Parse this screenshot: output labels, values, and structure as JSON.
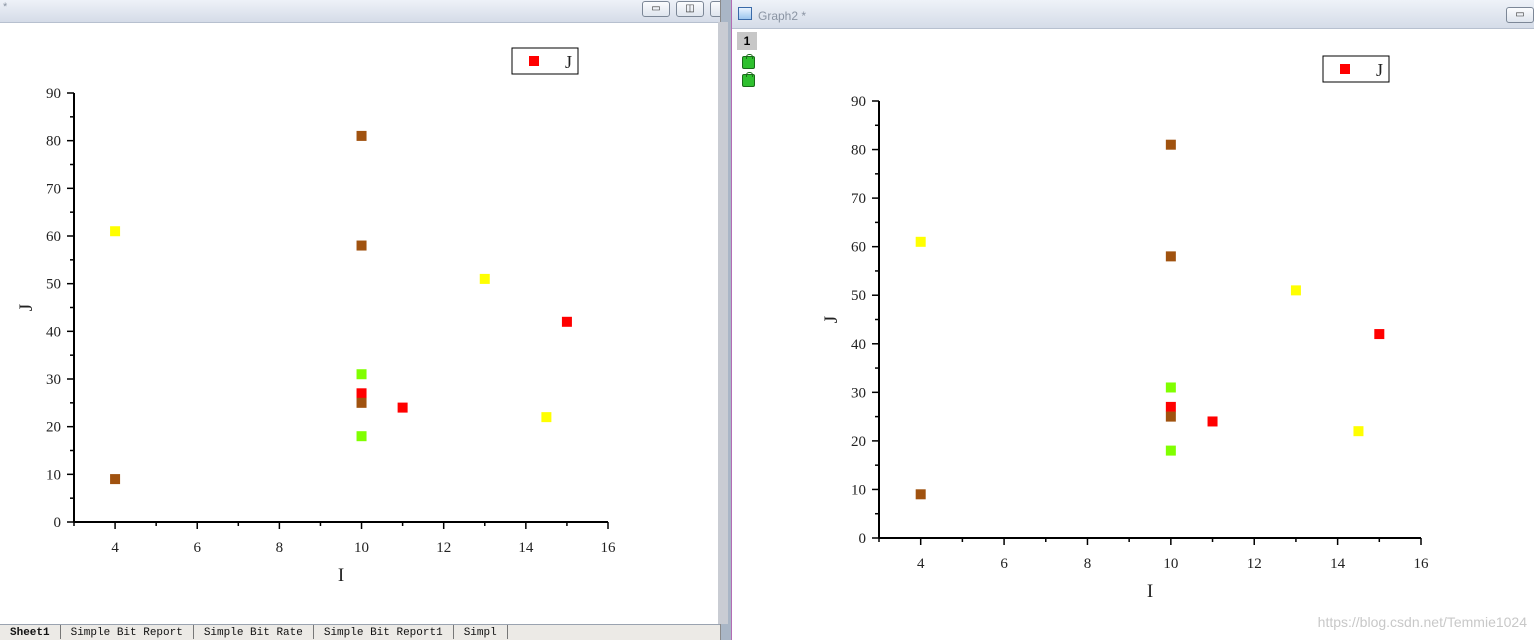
{
  "left_window": {
    "title_mark": "*",
    "buttons": {
      "minimize": "▭",
      "restore": "◫",
      "close": "✕"
    },
    "tabs": [
      "Sheet1",
      "Simple Bit Report",
      "Simple Bit Rate",
      "Simple Bit Report1",
      "Simpl"
    ]
  },
  "right_window": {
    "title": "Graph2 *",
    "layer_label": "1",
    "buttons": {
      "minimize": "▭"
    },
    "watermark": "https://blog.csdn.net/Temmie1024"
  },
  "chart_data": {
    "type": "scatter",
    "title": "",
    "xlabel": "I",
    "ylabel": "J",
    "xlim": [
      3,
      16
    ],
    "ylim": [
      0,
      90
    ],
    "xticks": [
      4,
      6,
      8,
      10,
      12,
      14,
      16
    ],
    "yticks": [
      0,
      10,
      20,
      30,
      40,
      50,
      60,
      70,
      80,
      90
    ],
    "legend": {
      "label": "J",
      "position": "top-right",
      "color": "#ff0000"
    },
    "colors": {
      "red": "#ff0000",
      "brown": "#a0520f",
      "yellow": "#ffff00",
      "green": "#80ff00"
    },
    "points": [
      {
        "x": 4,
        "y": 9,
        "color": "brown"
      },
      {
        "x": 4,
        "y": 61,
        "color": "yellow"
      },
      {
        "x": 10,
        "y": 81,
        "color": "brown"
      },
      {
        "x": 10,
        "y": 58,
        "color": "brown"
      },
      {
        "x": 10,
        "y": 31,
        "color": "green"
      },
      {
        "x": 10,
        "y": 27,
        "color": "red"
      },
      {
        "x": 10,
        "y": 25,
        "color": "brown"
      },
      {
        "x": 10,
        "y": 18,
        "color": "green"
      },
      {
        "x": 11,
        "y": 24,
        "color": "red"
      },
      {
        "x": 13,
        "y": 51,
        "color": "yellow"
      },
      {
        "x": 14.5,
        "y": 22,
        "color": "yellow"
      },
      {
        "x": 15,
        "y": 42,
        "color": "red"
      }
    ]
  }
}
